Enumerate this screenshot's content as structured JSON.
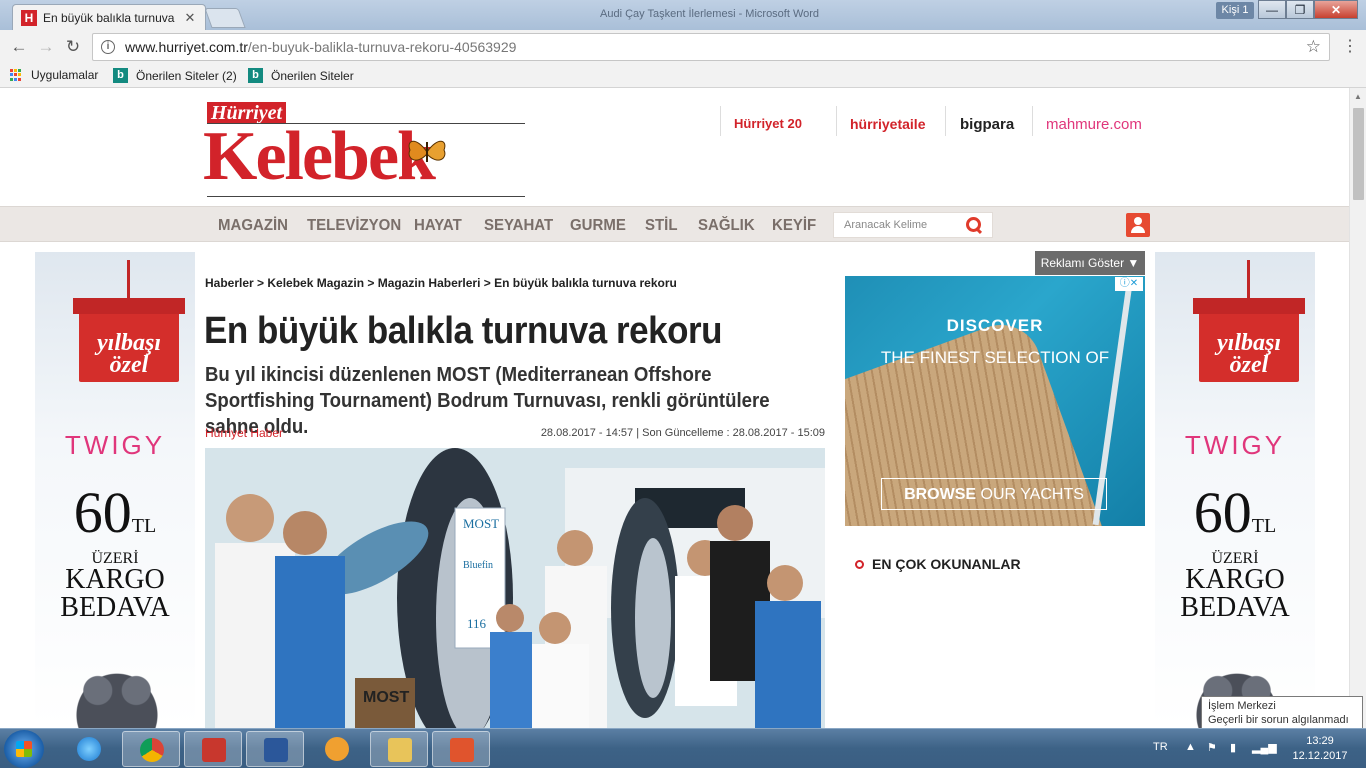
{
  "browser": {
    "tab_title": "En büyük balıkla turnuva",
    "tab_favicon": "H",
    "window_title": "Audi Çay Taşkent İlerlemesi - Microsoft Word",
    "user_label": "Kişi 1",
    "url_host": "www.hurriyet.com.tr",
    "url_path": "/en-buyuk-balikla-turnuva-rekoru-40563929",
    "bookmarks": [
      "Uygulamalar",
      "Önerilen Siteler (2)",
      "Önerilen Siteler"
    ]
  },
  "site": {
    "brand_top": "Hürriyet",
    "brand_main": "Kelebek",
    "partners": [
      "Hürriyet 20",
      "hürriyetaile",
      "bigpara",
      "mahmure.com"
    ],
    "nav_items": [
      "MAGAZİN",
      "TELEVİZYON",
      "HAYAT",
      "SEYAHAT",
      "GURME",
      "STİL",
      "SAĞLIK",
      "KEYİF"
    ],
    "search_placeholder": "Aranacak Kelime"
  },
  "article": {
    "breadcrumb": "Haberler > Kelebek Magazin > Magazin Haberleri > En büyük balıkla turnuva rekoru",
    "headline": "En büyük balıkla turnuva rekoru",
    "summary": "Bu yıl ikincisi düzenlenen MOST (Mediterranean Offshore Sportfishing Tournament) Bodrum Turnuvası, renkli görüntülere sahne oldu.",
    "author": "Hürriyet Haber",
    "dates": "28.08.2017 - 14:57 | Son Güncelleme : 28.08.2017 - 15:09",
    "photo_texts": [
      "MOST",
      "Bluefin",
      "116",
      "MOST"
    ]
  },
  "side_ad": {
    "gift_line1": "yılbaşı",
    "gift_line2": "özel",
    "brand": "TWIGY",
    "price": "60",
    "currency": "TL",
    "line1": "ÜZERİ",
    "line2": "KARGO",
    "line3": "BEDAVA"
  },
  "right_col": {
    "show_ad_button": "Reklamı Göster ▼",
    "ad_discover": "DISCOVER",
    "ad_finest": "THE FINEST SELECTION OF",
    "ad_browse_bold": "BROWSE",
    "ad_browse_rest": " OUR YACHTS",
    "most_read": "EN ÇOK OKUNANLAR"
  },
  "taskbar": {
    "lang": "TR",
    "time": "13:29",
    "date": "12.12.2017",
    "tooltip_title": "İşlem Merkezi",
    "tooltip_body": "Geçerli bir sorun algılanmadı"
  }
}
